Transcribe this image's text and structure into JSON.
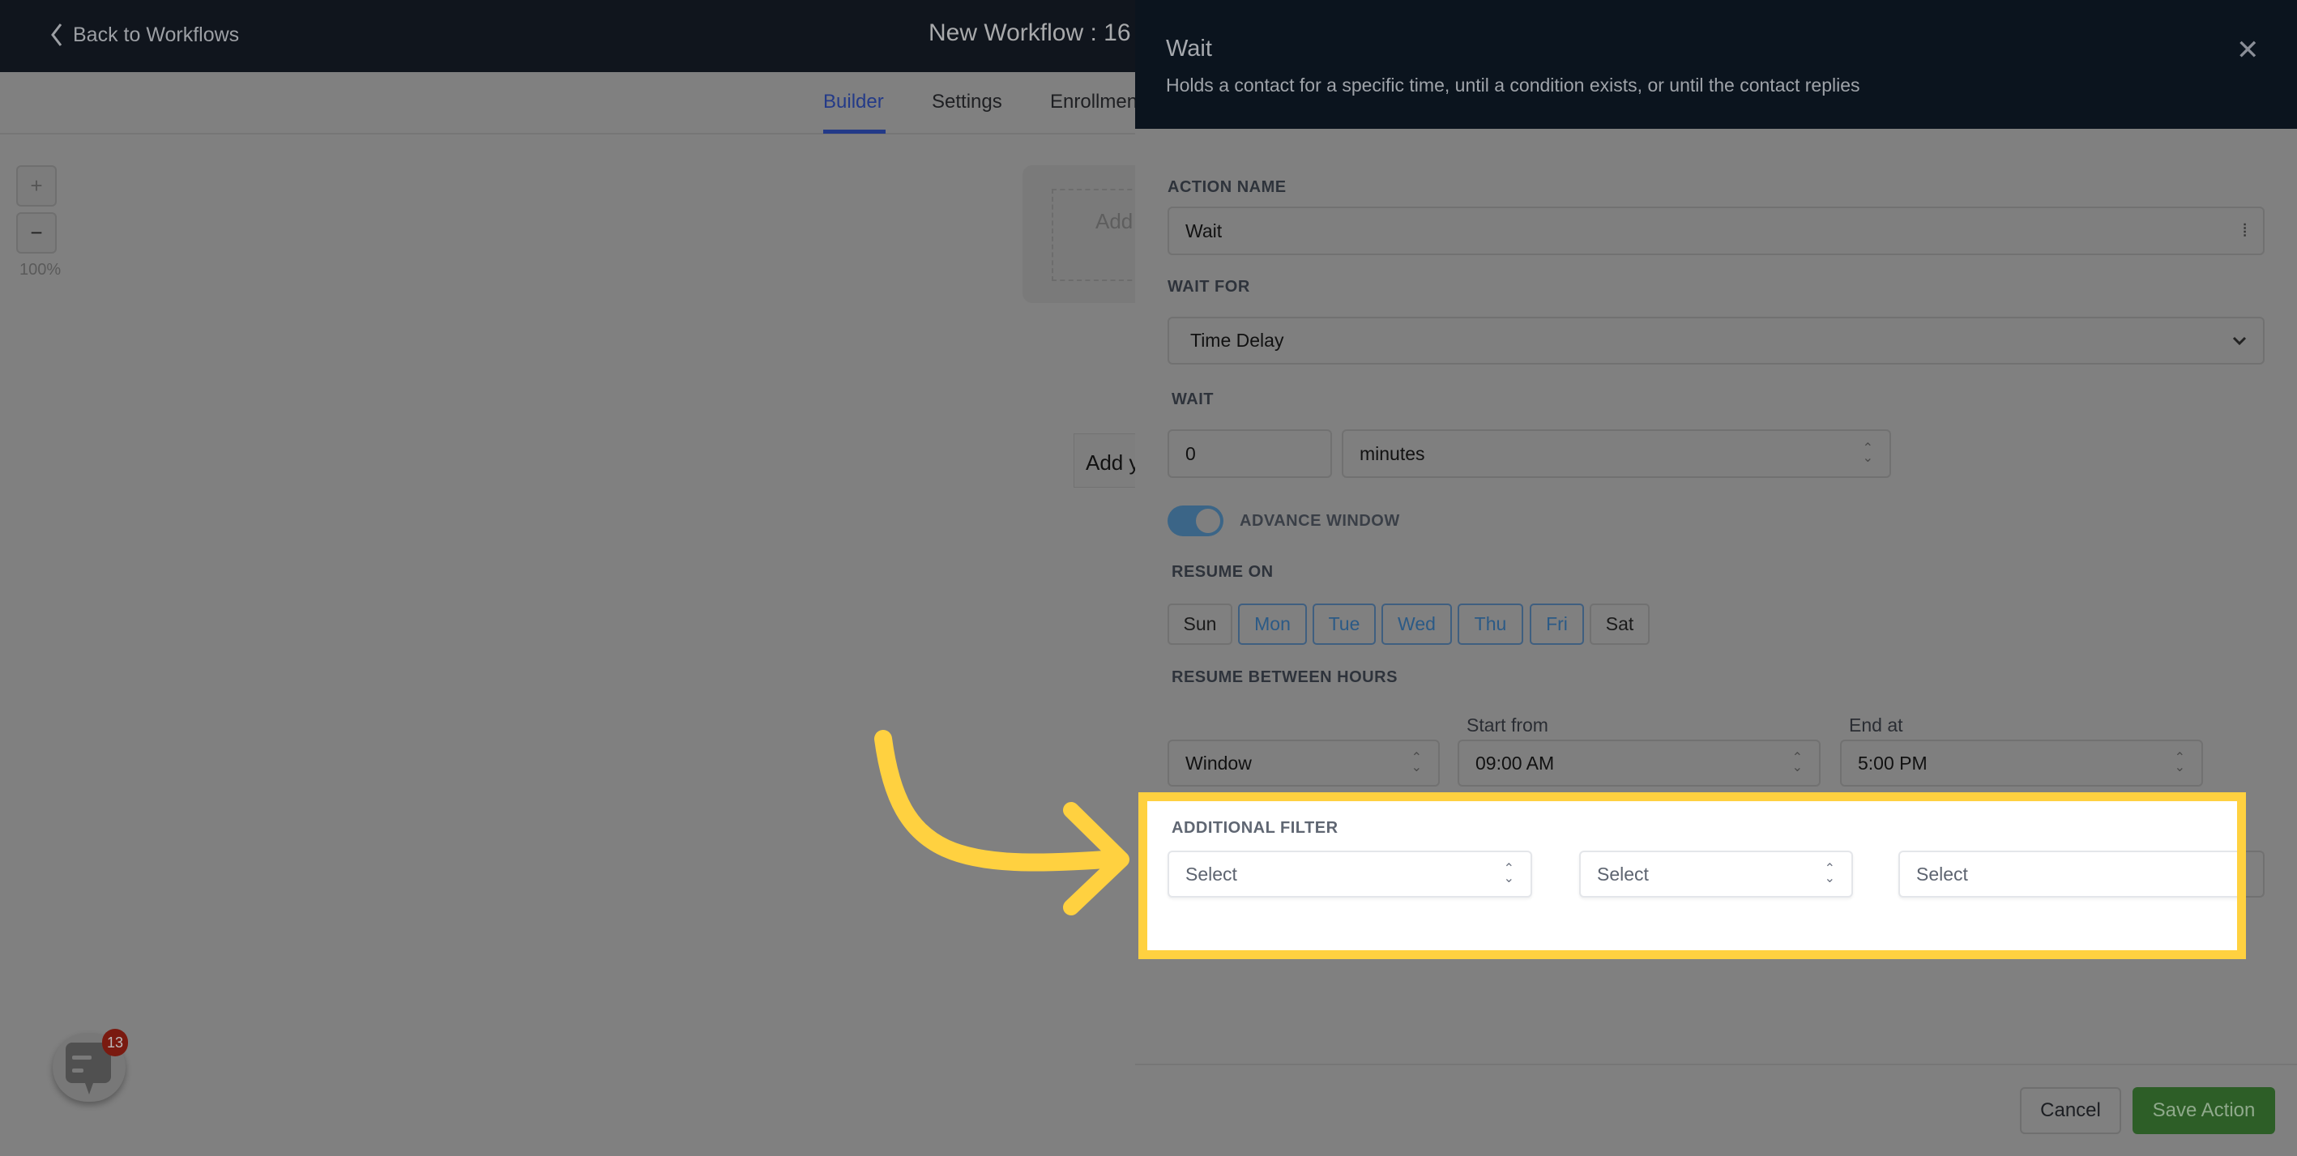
{
  "header": {
    "back_label": "Back to Workflows",
    "title": "New Workflow : 16"
  },
  "tabs": [
    {
      "label": "Builder",
      "active": true
    },
    {
      "label": "Settings"
    },
    {
      "label": "Enrollmen"
    }
  ],
  "canvas": {
    "zoom_in": "+",
    "zoom_out": "−",
    "zoom_level": "100%",
    "node_text": "Add",
    "add_text": "Add y"
  },
  "chat": {
    "badge_count": "13"
  },
  "panel": {
    "title": "Wait",
    "subtitle": "Holds a contact for a specific time, until a condition exists, or until the contact replies",
    "action_name_label": "ACTION NAME",
    "action_name_value": "Wait",
    "wait_for_label": "WAIT FOR",
    "wait_for_value": "Time Delay",
    "wait_label": "WAIT",
    "wait_amount": "0",
    "wait_unit": "minutes",
    "advance_window_label": "ADVANCE WINDOW",
    "advance_window_on": true,
    "resume_on_label": "RESUME ON",
    "days": [
      {
        "label": "Sun",
        "selected": false
      },
      {
        "label": "Mon",
        "selected": true
      },
      {
        "label": "Tue",
        "selected": true
      },
      {
        "label": "Wed",
        "selected": true
      },
      {
        "label": "Thu",
        "selected": true
      },
      {
        "label": "Fri",
        "selected": true
      },
      {
        "label": "Sat",
        "selected": false
      }
    ],
    "resume_between_label": "RESUME BETWEEN HOURS",
    "window_value": "Window",
    "start_label": "Start from",
    "start_value": "09:00 AM",
    "end_label": "End at",
    "end_value": "5:00 PM",
    "additional_filter_label": "ADDITIONAL FILTER",
    "filter_selects": [
      "Select",
      "Select",
      "Select"
    ],
    "cancel_label": "Cancel",
    "save_label": "Save Action"
  },
  "colors": {
    "highlight": "#ffd140",
    "save": "#2d5e27",
    "selected_day": "#2b5a86"
  }
}
